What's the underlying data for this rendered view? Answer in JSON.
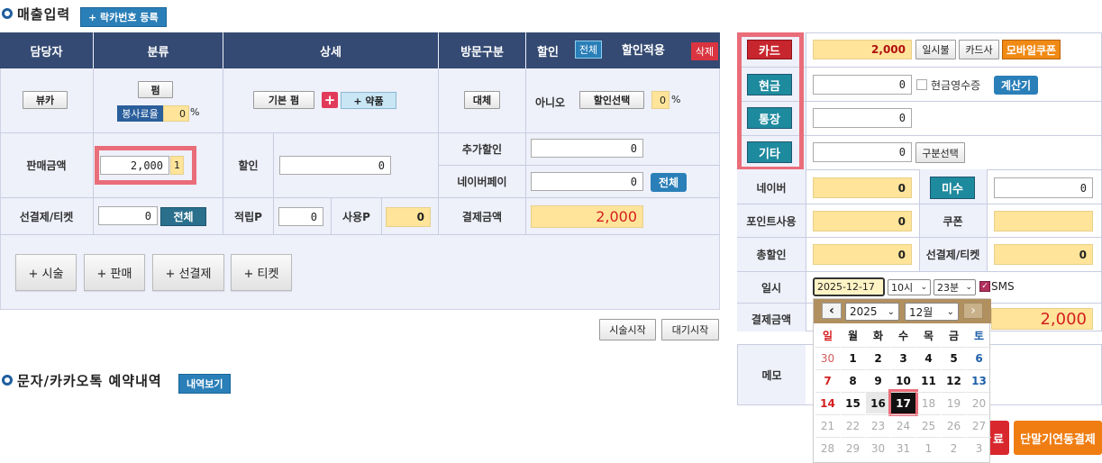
{
  "section1": {
    "title": "매출입력",
    "tag_button": "+ 락카번호 등록"
  },
  "table_headers": {
    "manager": "담당자",
    "category": "분류",
    "detail": "상세",
    "visit_type": "방문구분",
    "discount": "할인",
    "all_btn": "전체",
    "discount_apply": "할인적용",
    "delete_btn": "삭제"
  },
  "row1": {
    "manager_btn": "뷰카",
    "category_btn": "펌",
    "service_rate_label": "봉사료율",
    "service_rate_value": "0",
    "percent": "%",
    "basic_perm_btn": "기본 펌",
    "plus_icon": "+",
    "drug_btn": "+ 약품",
    "visit_btn": "대체",
    "discount_value": "아니오",
    "discount_select_btn": "할인선택",
    "discount_rate_value": "0"
  },
  "row2": {
    "sale_amount_label": "판매금액",
    "sale_amount_value": "2,000",
    "sale_qty": "1",
    "discount_label": "할인",
    "discount_value": "0",
    "extra_discount_label": "추가할인",
    "extra_discount_value": "0",
    "naverpay_label": "네이버페이",
    "naverpay_value": "0",
    "naverpay_all_btn": "전체"
  },
  "row3": {
    "prepay_label": "선결제/티켓",
    "prepay_value": "0",
    "prepay_all_btn": "전체",
    "point_label": "적립P",
    "point_value": "0",
    "use_point_label": "사용P",
    "use_point_value": "0",
    "pay_amount_label": "결제금액",
    "pay_amount_value": "2,000"
  },
  "action_buttons": [
    "+ 시술",
    "+ 판매",
    "+ 선결제",
    "+ 티켓"
  ],
  "bottom_buttons": {
    "start_treatment": "시술시작",
    "start_wait": "대기시작"
  },
  "section2": {
    "title": "문자/카카오톡 예약내역",
    "tag_button": "내역보기"
  },
  "right_panel": {
    "card_btn": "카드",
    "card_value": "2,000",
    "lump_btn": "일시불",
    "card_company_btn": "카드사",
    "mobile_coupon_btn": "모바일쿠폰",
    "cash_btn": "현금",
    "cash_value": "0",
    "cash_receipt_label": "현금영수증",
    "calculator_btn": "계산기",
    "bankbook_btn": "통장",
    "bankbook_value": "0",
    "etc_btn": "기타",
    "etc_value": "0",
    "type_select_btn": "구분선택",
    "naver_label": "네이버",
    "naver_value": "0",
    "unpaid_btn": "미수",
    "unpaid_value": "0",
    "point_use_label": "포인트사용",
    "point_use_value": "0",
    "coupon_label": "쿠폰",
    "coupon_value": "",
    "total_discount_label": "총할인",
    "total_discount_value": "0",
    "prepay_label": "선결제/티켓",
    "prepay_value": "0",
    "date_label": "일시",
    "date_value": "2025-12-17",
    "hour_value": "10시",
    "minute_value": "23분",
    "sms_label": "SMS",
    "pay_amount_label": "결제금액",
    "pay_amount_value": "2,000",
    "memo_label": "메모",
    "terminal_btn": "단말기연동결제",
    "partial_btn_text": "료"
  },
  "calendar": {
    "year": "2025",
    "month": "12월",
    "prev_icon": "‹",
    "next_icon": "›",
    "weekdays": [
      "일",
      "월",
      "화",
      "수",
      "목",
      "금",
      "토"
    ],
    "weeks": [
      [
        "30",
        "1",
        "2",
        "3",
        "4",
        "5",
        "6"
      ],
      [
        "7",
        "8",
        "9",
        "10",
        "11",
        "12",
        "13"
      ],
      [
        "14",
        "15",
        "16",
        "17",
        "18",
        "19",
        "20"
      ],
      [
        "21",
        "22",
        "23",
        "24",
        "25",
        "26",
        "27"
      ],
      [
        "28",
        "29",
        "30",
        "31",
        "1",
        "2",
        "3"
      ]
    ],
    "selected": "17"
  },
  "colors": {
    "header": "#344a72",
    "accent": "#2a7fb8",
    "teal_btn": "#2a6f8c",
    "highlight": "#ea6d7a",
    "yellow": "#ffe49a"
  }
}
